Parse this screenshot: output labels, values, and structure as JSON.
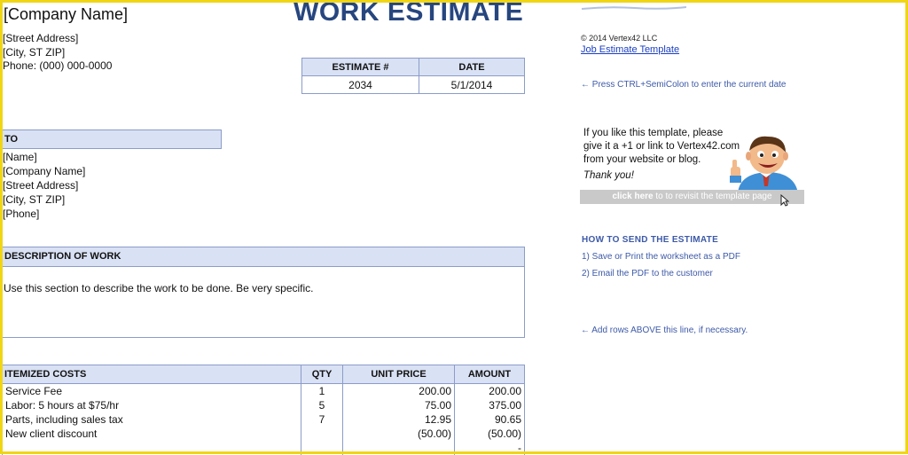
{
  "document": {
    "company_name": "[Company Name]",
    "title": "WORK ESTIMATE",
    "street": "[Street Address]",
    "city": "[City, ST  ZIP]",
    "phone": "Phone: (000) 000-0000",
    "estimate_header": "ESTIMATE #",
    "date_header": "DATE",
    "estimate_number": "2034",
    "date": "5/1/2014",
    "to_header": "TO",
    "to_lines": [
      "[Name]",
      "[Company Name]",
      "[Street Address]",
      "[City, ST  ZIP]",
      "[Phone]"
    ],
    "description_header": "DESCRIPTION OF WORK",
    "description_text": "Use this section to describe the work to be done. Be very specific.",
    "items_headers": [
      "ITEMIZED COSTS",
      "QTY",
      "UNIT PRICE",
      "AMOUNT"
    ],
    "items": [
      {
        "desc": "Service Fee",
        "qty": "1",
        "unit": "200.00",
        "amount": "200.00"
      },
      {
        "desc": "Labor: 5 hours at $75/hr",
        "qty": "5",
        "unit": "75.00",
        "amount": "375.00"
      },
      {
        "desc": "Parts, including sales tax",
        "qty": "7",
        "unit": "12.95",
        "amount": "90.65"
      },
      {
        "desc": "New client discount",
        "qty": "",
        "unit": "(50.00)",
        "amount": "(50.00)"
      },
      {
        "desc": "",
        "qty": "",
        "unit": "",
        "amount": "-"
      }
    ]
  },
  "sidebar": {
    "copyright": "© 2014 Vertex42 LLC",
    "template_link": "Job Estimate Template",
    "date_hint": "← Press CTRL+SemiColon to enter the current date",
    "promo_lines": [
      "If you like this template, please",
      "give it a +1 or link to Vertex42.com",
      "from your website or blog."
    ],
    "thanks": "Thank you!",
    "revisit_bold": "click here",
    "revisit_rest": " to to revisit the template page",
    "send_title": "HOW TO SEND THE ESTIMATE",
    "send_steps": [
      "1) Save or Print the worksheet as a PDF",
      "2) Email the PDF to the customer"
    ],
    "rows_hint": "← Add rows ABOVE this line, if necessary."
  },
  "colors": {
    "frame": "#f0d515",
    "title": "#27467f",
    "header_fill": "#d9e1f4",
    "link": "#1a3ec2",
    "hint": "#3d5aa8"
  },
  "icons": [
    "mascot-thumbs-up-illustration",
    "mouse-cursor-icon",
    "vertex42-logo-swoosh"
  ]
}
